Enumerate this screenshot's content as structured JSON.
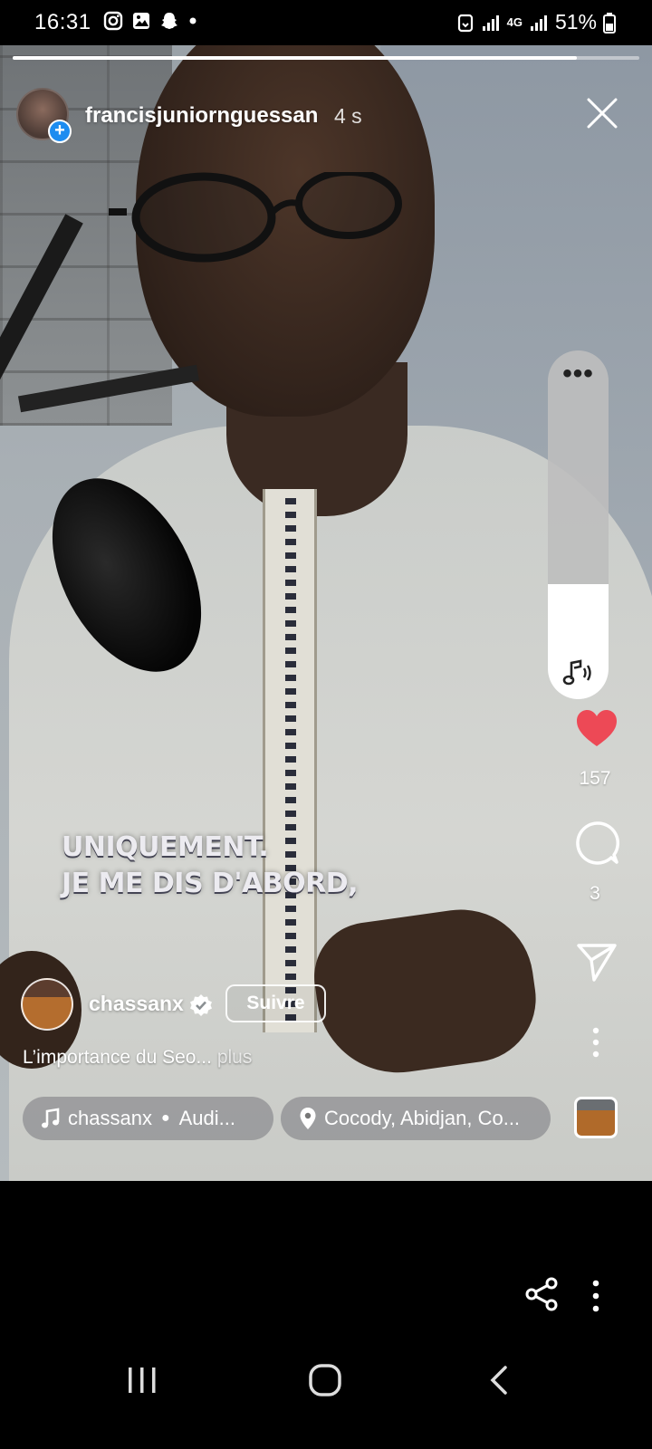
{
  "status_bar": {
    "time": "16:31",
    "left_icons": [
      "instagram-icon",
      "gallery-icon",
      "snapchat-icon",
      "dot-icon"
    ],
    "right_icons": [
      "alarm-icon",
      "signal-icon",
      "4g-data-icon",
      "signal-icon",
      "battery-icon"
    ],
    "network": "4G",
    "battery": "51%"
  },
  "story": {
    "progress_fraction": 0.9,
    "username": "francisjuniornguessan",
    "time_ago": "4 s"
  },
  "video": {
    "caption_line1": "UNIQUEMENT.",
    "caption_line2": "JE ME DIS D'ABORD,"
  },
  "volume": {
    "level_fraction": 0.33,
    "more_label": "•••"
  },
  "actions": {
    "likes": "157",
    "comments": "3"
  },
  "reel": {
    "creator": "chassanx",
    "follow_label": "Suivre",
    "description": "L’importance du Seo...",
    "more_label": "plus",
    "audio_artist": "chassanx",
    "audio_title": "Audi...",
    "location": "Cocody, Abidjan, Co..."
  },
  "colors": {
    "like_red": "#ed4956",
    "verified_gray": "#ffffff",
    "plus_blue": "#1d8cf0"
  }
}
